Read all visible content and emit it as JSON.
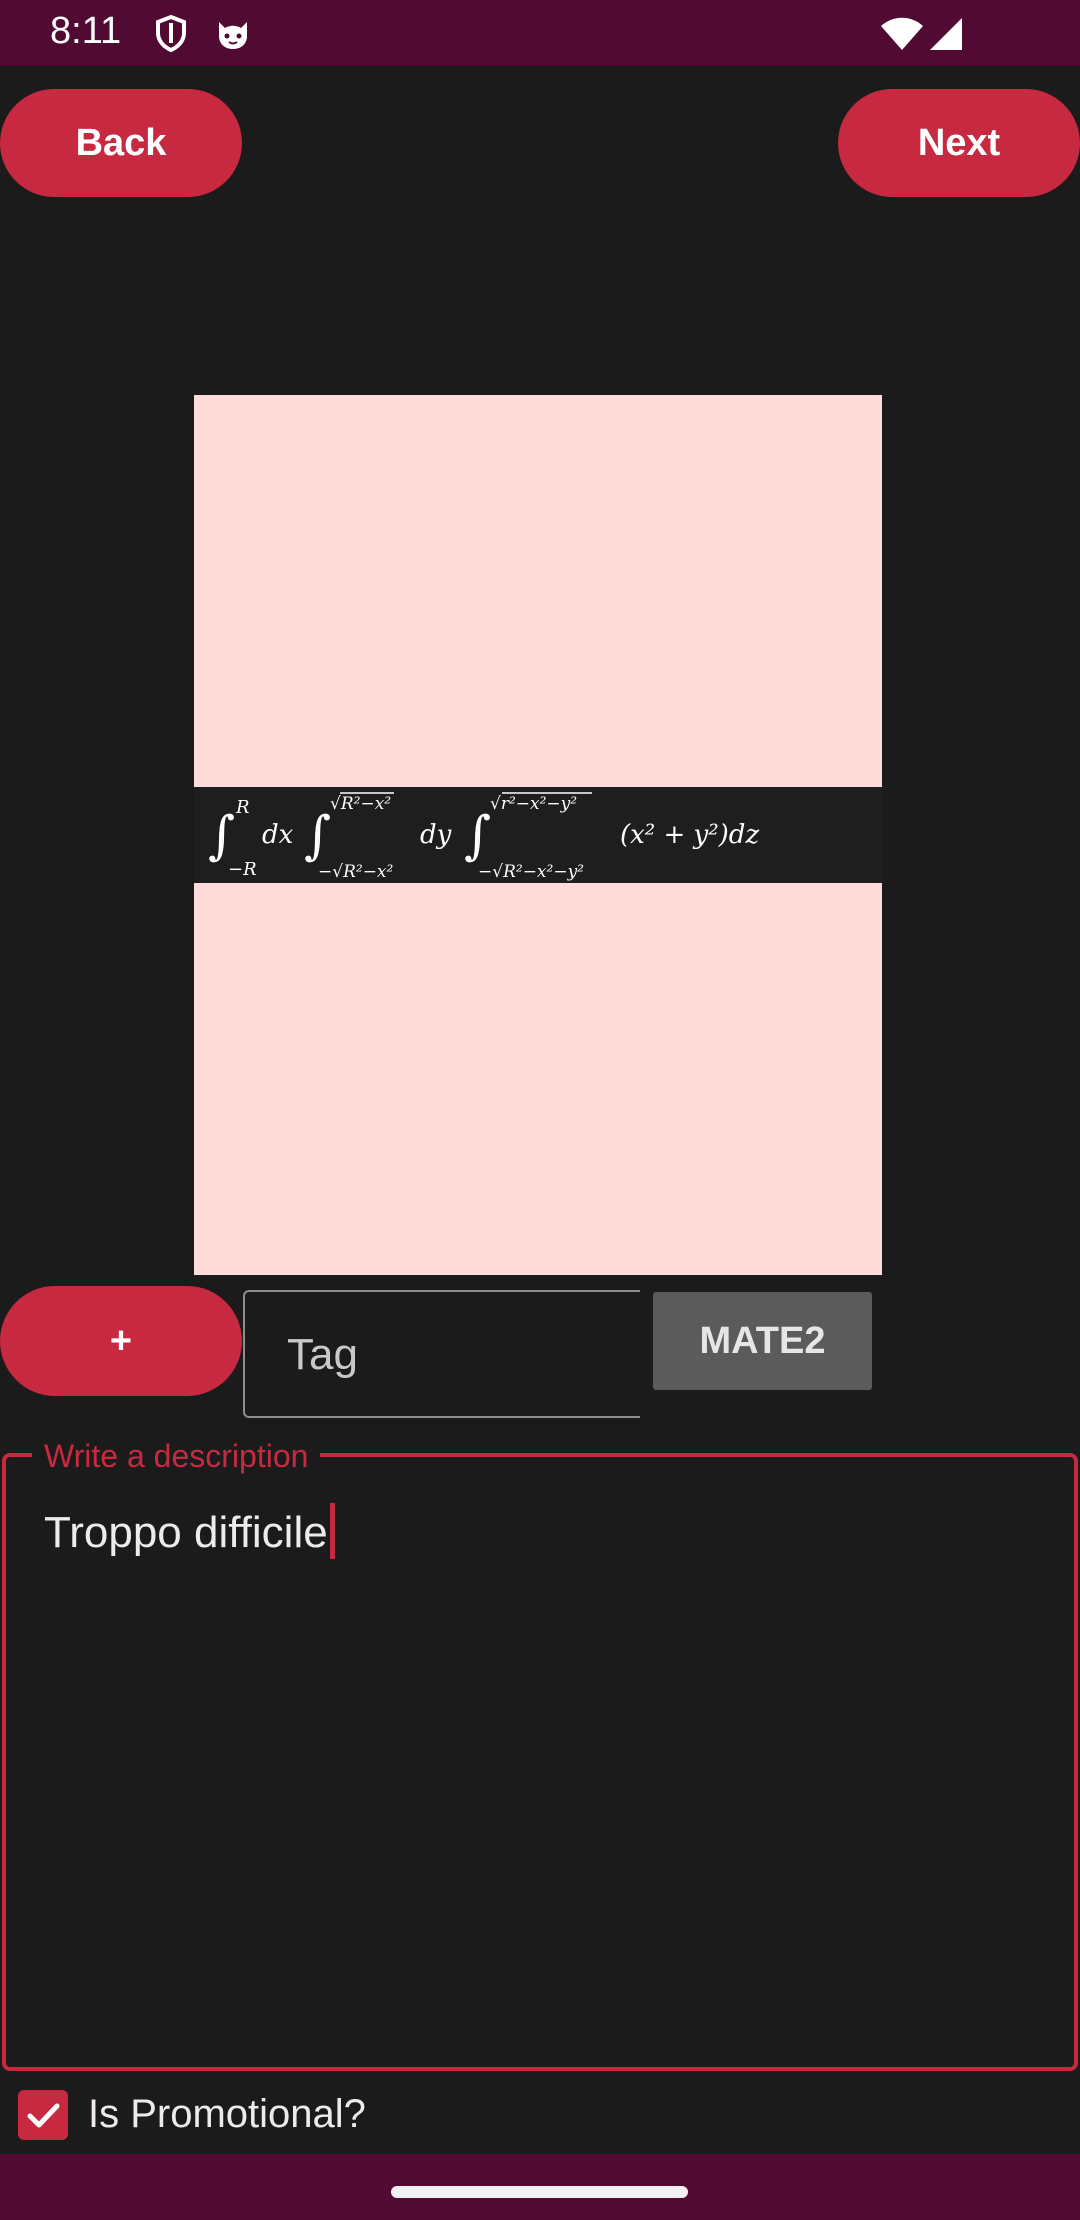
{
  "status_bar": {
    "time": "8:11",
    "icons": [
      "shield-icon",
      "cat-face-icon",
      "wifi-icon",
      "signal-icon"
    ]
  },
  "toolbar": {
    "back_label": "Back",
    "next_label": "Next"
  },
  "image": {
    "formula_alt": "∫ from −R to R dx ∫ from −√(R²−x²) to √(R²−x²) dy ∫ from −√(R²−x²−y²) to √(r²−x²−y²) (x² + y²) dz"
  },
  "tags": {
    "add_label": "+",
    "input_placeholder": "Tag",
    "chips": [
      "MATE2"
    ]
  },
  "description": {
    "legend": "Write a description",
    "value": "Troppo difficile"
  },
  "promotional": {
    "label": "Is Promotional?",
    "checked": true
  },
  "colors": {
    "accent": "#c72a40",
    "system_bars": "#510a32",
    "background": "#1b1b1b",
    "image_bg": "#ffdbda",
    "chip_bg": "#5b5b5b"
  }
}
